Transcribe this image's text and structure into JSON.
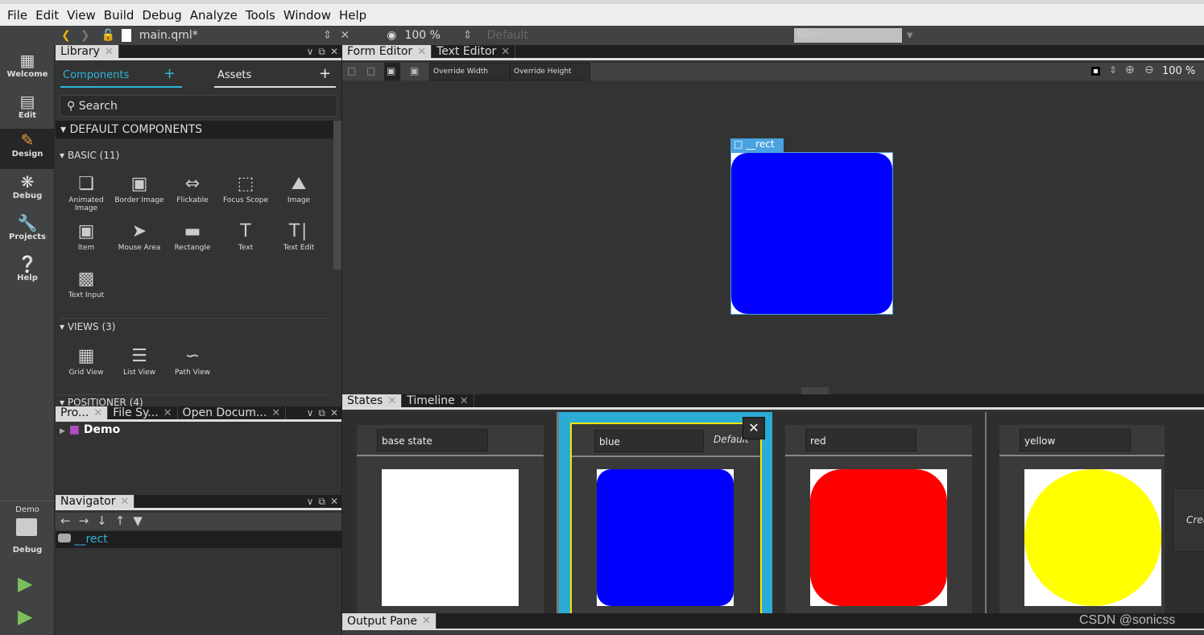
{
  "menu": [
    "File",
    "Edit",
    "View",
    "Build",
    "Debug",
    "Analyze",
    "Tools",
    "Window",
    "Help"
  ],
  "toolbar": {
    "file": "main.qml*",
    "zoom": "100 %",
    "state": "Default",
    "style": "Basic"
  },
  "modes": [
    {
      "label": "Welcome",
      "icon": "grid-icon"
    },
    {
      "label": "Edit",
      "icon": "document-icon"
    },
    {
      "label": "Design",
      "icon": "pencil-icon"
    },
    {
      "label": "Debug",
      "icon": "bug-icon"
    },
    {
      "label": "Projects",
      "icon": "wrench-icon"
    },
    {
      "label": "Help",
      "icon": "help-icon"
    }
  ],
  "kit": {
    "project": "Demo",
    "build": "Debug"
  },
  "library": {
    "tab": "Library",
    "components_tab": "Components",
    "assets_tab": "Assets",
    "search_placeholder": "Search",
    "section": "DEFAULT COMPONENTS",
    "basic_title": "BASIC (11)",
    "basic": [
      "Animated Image",
      "Border Image",
      "Flickable",
      "Focus Scope",
      "Image",
      "Item",
      "Mouse Area",
      "Rectangle",
      "Text",
      "Text Edit",
      "Text Input"
    ],
    "views_title": "VIEWS (3)",
    "views": [
      "Grid View",
      "List View",
      "Path View"
    ],
    "positioner_title": "POSITIONER (4)"
  },
  "projects": {
    "tabs": [
      "Pro...",
      "File Sy...",
      "Open Docum..."
    ],
    "root": "Demo"
  },
  "navigator": {
    "tab": "Navigator",
    "item": "__rect"
  },
  "editor": {
    "tabs": [
      "Form Editor",
      "Text Editor"
    ],
    "override_width": "Override Width",
    "override_height": "Override Height",
    "zoom": "100 %",
    "selected": "__rect",
    "rect_color": "#0000ff"
  },
  "states": {
    "tabs": [
      "States",
      "Timeline"
    ],
    "items": [
      {
        "name": "base state"
      },
      {
        "name": "blue",
        "default": "Default",
        "color": "#0000ff"
      },
      {
        "name": "red",
        "color": "#ff0000"
      },
      {
        "name": "yellow",
        "color": "#ffff00"
      }
    ],
    "create": "Create"
  },
  "output": {
    "tab": "Output Pane"
  },
  "watermark": "CSDN @sonicss"
}
